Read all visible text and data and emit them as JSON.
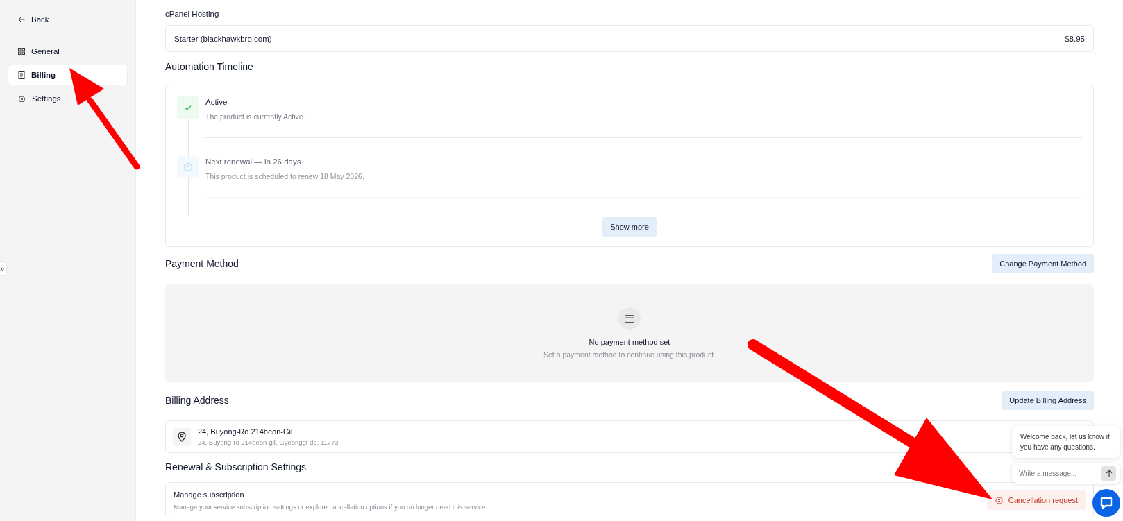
{
  "sidebar": {
    "back": "Back",
    "toggle": "»",
    "items": [
      {
        "label": "General",
        "selected": false
      },
      {
        "label": "Billing",
        "selected": true
      },
      {
        "label": "Settings",
        "selected": false
      }
    ]
  },
  "product": {
    "category": "cPanel Hosting",
    "plan": "Starter  (blackhawkbro.com)",
    "price": "$8.95"
  },
  "timeline": {
    "title": "Automation Timeline",
    "events": [
      {
        "title": "Active",
        "text": "The product is currently Active.",
        "kind": "done",
        "faded": false
      },
      {
        "title": "Next renewal — in 26 days",
        "text": "This product is scheduled to renew 18 May 2026.",
        "kind": "pending",
        "faded": true
      }
    ],
    "show_more": "Show more"
  },
  "payment": {
    "title": "Payment Method",
    "button": "Change Payment Method",
    "empty_title": "No payment method set",
    "empty_text": "Set a payment method to continue using this product."
  },
  "billing_address": {
    "title": "Billing Address",
    "button": "Update Billing Address",
    "line1": "24, Buyong-Ro 214beon-Gil",
    "line2": "24, Buyong-ro 214beon-gil, Gyeonggi-do, 11773"
  },
  "renewal": {
    "title": "Renewal & Subscription Settings",
    "label": "Manage subscription",
    "text": "Manage your service subscription settings or explore cancellation options if you no longer need this service.",
    "button": "Cancellation request"
  },
  "chat": {
    "message": "Welcome back, let us know if you have any questions.",
    "placeholder": "Write a message..."
  }
}
